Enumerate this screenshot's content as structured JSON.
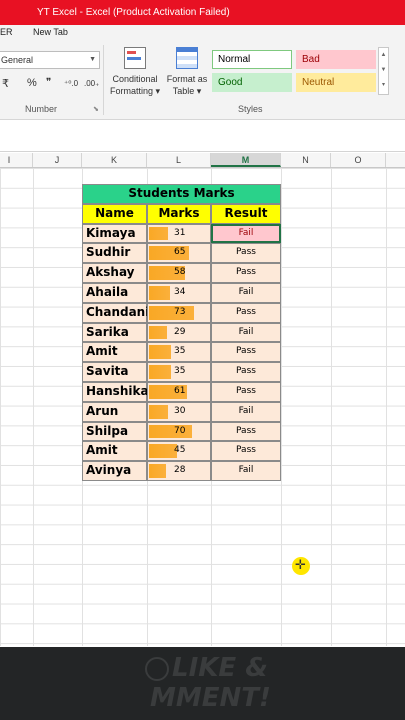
{
  "titlebar": {
    "title": "YT Excel -  Excel (Product Activation Failed)"
  },
  "ribbon_tabs": {
    "tab_er": "ER",
    "tab_new": "New Tab"
  },
  "ribbon": {
    "number_format": "General",
    "number_group_label": "Number",
    "currency_symbol": "₹",
    "percent_symbol": "%",
    "comma_symbol": "❞",
    "inc_decimal": "⁺⁰.0",
    "dec_decimal": ".00₊",
    "cond_format_line1": "Conditional",
    "cond_format_line2": "Formatting ▾",
    "format_table_line1": "Format as",
    "format_table_line2": "Table ▾",
    "styles_group_label": "Styles",
    "styles": [
      {
        "label": "Normal",
        "bg": "#ffffff",
        "fg": "#000000",
        "border": "#7fc97f"
      },
      {
        "label": "Bad",
        "bg": "#ffc7ce",
        "fg": "#9c0006",
        "border": "#ffc7ce"
      },
      {
        "label": "Good",
        "bg": "#c6efce",
        "fg": "#006100",
        "border": "#c6efce"
      },
      {
        "label": "Neutral",
        "bg": "#ffeb9c",
        "fg": "#9c5700",
        "border": "#ffeb9c"
      }
    ]
  },
  "columns": [
    "I",
    "J",
    "K",
    "L",
    "M",
    "N",
    "O"
  ],
  "active_column": "M",
  "table": {
    "title": "Students Marks",
    "headers": {
      "name": "Name",
      "marks": "Marks",
      "result": "Result"
    },
    "max_marks": 100,
    "rows": [
      {
        "name": "Kimaya",
        "marks": 31,
        "result": "Fail"
      },
      {
        "name": "Sudhir",
        "marks": 65,
        "result": "Pass"
      },
      {
        "name": "Akshay",
        "marks": 58,
        "result": "Pass"
      },
      {
        "name": "Ahaila",
        "marks": 34,
        "result": "Fail"
      },
      {
        "name": "Chandani",
        "marks": 73,
        "result": "Pass"
      },
      {
        "name": "Sarika",
        "marks": 29,
        "result": "Fail"
      },
      {
        "name": "Amit",
        "marks": 35,
        "result": "Pass"
      },
      {
        "name": "Savita",
        "marks": 35,
        "result": "Pass"
      },
      {
        "name": "Hanshika",
        "marks": 61,
        "result": "Pass"
      },
      {
        "name": "Arun",
        "marks": 30,
        "result": "Fail"
      },
      {
        "name": "Shilpa",
        "marks": 70,
        "result": "Pass"
      },
      {
        "name": "Amit",
        "marks": 45,
        "result": "Pass"
      },
      {
        "name": "Avinya",
        "marks": 28,
        "result": "Fail"
      }
    ]
  },
  "banner": {
    "line1": "LIKE &",
    "line2": "MMENT!"
  }
}
